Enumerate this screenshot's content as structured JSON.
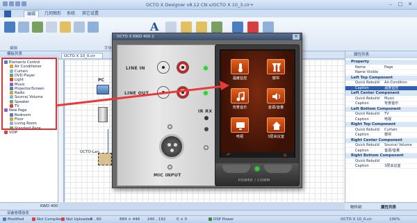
{
  "titlebar": {
    "title": "OCTO X Designer v8.12 CN v/OCTO X 10_3.cir+",
    "minimize": "–",
    "maximize": "□",
    "close": "✕"
  },
  "ribbon": {
    "tabs": [
      "编辑",
      "几何图形",
      "系统",
      "其它设置"
    ],
    "groups": [
      "编辑",
      "字体"
    ]
  },
  "left_panel": {
    "header": "模板列表",
    "tree": [
      {
        "label": "Elements Control",
        "level": 0
      },
      {
        "label": "Air Conditioner",
        "level": 1
      },
      {
        "label": "Curtain",
        "level": 1
      },
      {
        "label": "DVD Player",
        "level": 1
      },
      {
        "label": "Light",
        "level": 1
      },
      {
        "label": "Music",
        "level": 1
      },
      {
        "label": "Projector/Screen",
        "level": 1
      },
      {
        "label": "Radio",
        "level": 1
      },
      {
        "label": "Source/ Volume",
        "level": 1
      },
      {
        "label": "Speaker",
        "level": 1
      },
      {
        "label": "TV",
        "level": 1
      },
      {
        "label": "New Page",
        "level": 0
      },
      {
        "label": "Bedroom",
        "level": 1
      },
      {
        "label": "Floor",
        "level": 1
      },
      {
        "label": "Living Room",
        "level": 1
      },
      {
        "label": "Standard Page",
        "level": 1
      },
      {
        "label": "VOIP",
        "level": 0
      }
    ],
    "bottom_tab": "KWD 400",
    "log_title": "设备管理信息"
  },
  "doc_tab": "OCTO X 10_0.cir",
  "canvas": {
    "pc_label": "PC",
    "device_label": "OCTO-Lan"
  },
  "device_window": {
    "title": "OCTO X KWD 400 2",
    "line_in": "LINE IN",
    "line_out": "LINE OUT",
    "ir_rx": "IR RX",
    "mic_input": "MIC INPUT",
    "power_comm": "POWER / COMM",
    "tiles": [
      {
        "label": "温度监控",
        "icon": "thermometer-icon"
      },
      {
        "label": "窗帘",
        "icon": "curtain-icon"
      },
      {
        "label": "背景音乐",
        "icon": "music-note-icon"
      },
      {
        "label": "音源/音量",
        "icon": "speaker-icon"
      },
      {
        "label": "电视",
        "icon": "tv-icon"
      },
      {
        "label": "3层会议室",
        "icon": "house-icon"
      }
    ]
  },
  "right_panel": {
    "header": "属性列表",
    "sections": [
      {
        "title": "Property",
        "rows": [
          {
            "k": "Name",
            "v": "Page"
          },
          {
            "k": "Name Visible",
            "v": ""
          }
        ]
      },
      {
        "title": "Left Top Component",
        "rows": [
          {
            "k": "Quick Rebuild",
            "v": "Air-Condition"
          },
          {
            "k": "Caption",
            "v": "温度监控",
            "selected": true
          }
        ]
      },
      {
        "title": "Left Center Component",
        "rows": [
          {
            "k": "Quick Rebuild",
            "v": "Music"
          },
          {
            "k": "Caption",
            "v": "背景音乐"
          }
        ]
      },
      {
        "title": "Left Bottom Component",
        "rows": [
          {
            "k": "Quick Rebuild",
            "v": "TV"
          },
          {
            "k": "Caption",
            "v": "电视"
          }
        ]
      },
      {
        "title": "Right Top Component",
        "rows": [
          {
            "k": "Quick Rebuild",
            "v": "Curtain"
          },
          {
            "k": "Caption",
            "v": "窗帘"
          }
        ]
      },
      {
        "title": "Right Center Component",
        "rows": [
          {
            "k": "Quick Rebuild",
            "v": "Source/ Volume"
          },
          {
            "k": "Caption",
            "v": "音源/音量"
          }
        ]
      },
      {
        "title": "Right Bottom Component",
        "rows": [
          {
            "k": "Quick Rebuild",
            "v": ""
          },
          {
            "k": "Caption",
            "v": "3层会议室"
          }
        ]
      }
    ],
    "bottom_tabs": [
      "物件树",
      "属性列表"
    ]
  },
  "statusbar": {
    "modified": "Modified",
    "compiled": "Not Compiled",
    "uploaded": "Not Uploaded",
    "pos": "0 , 60",
    "size": "884 × 446",
    "offset": "240 , 192",
    "sel": "0 × 0",
    "dsp": "DSP Power",
    "file": "OCTO X 10_0.cir",
    "zoom": "100%"
  },
  "colors": {
    "highlight_box": "#e03030",
    "arrow": "#e83a3a",
    "tile_orange": "#e0601a"
  }
}
